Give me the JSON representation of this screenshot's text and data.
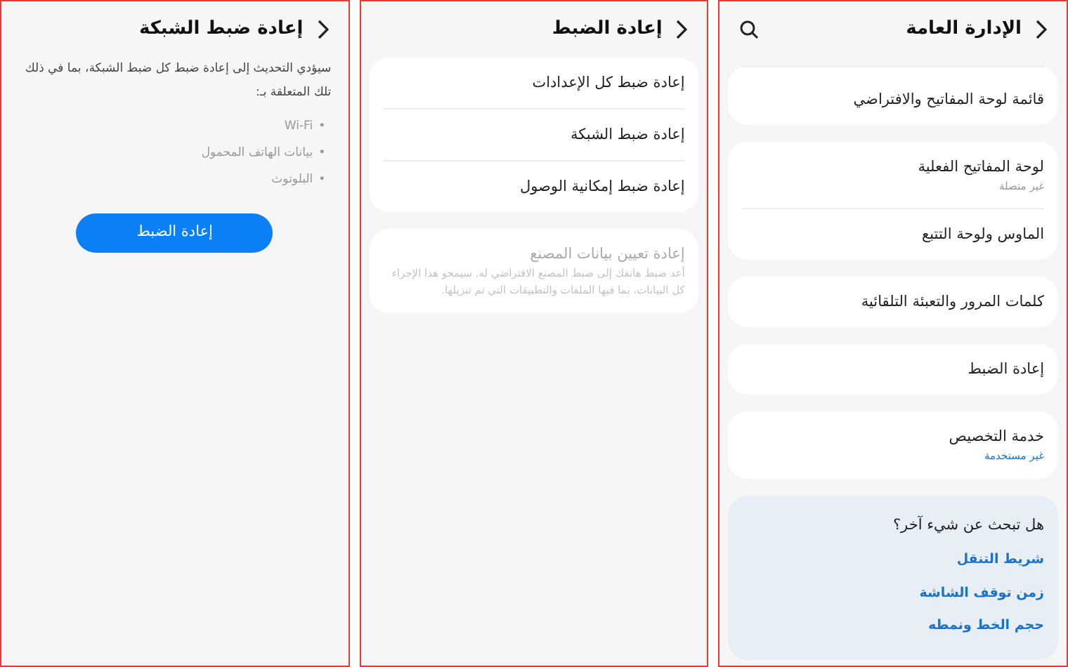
{
  "network_reset_screen": {
    "title": "إعادة ضبط الشبكة",
    "description": "سيؤدي التحديث إلى إعادة ضبط كل ضبط الشبكة، بما في ذلك تلك المتعلقة بـ:",
    "bullet": "•",
    "bullets": [
      "Wi-Fi",
      "بيانات الهاتف المحمول",
      "البلوتوث"
    ],
    "button": "إعادة الضبط"
  },
  "reset_screen": {
    "title": "إعادة الضبط",
    "groups": [
      {
        "items": [
          {
            "label": "إعادة ضبط كل الإعدادات",
            "disabled": false
          },
          {
            "label": "إعادة ضبط الشبكة",
            "disabled": false
          },
          {
            "label": "إعادة ضبط إمكانية الوصول",
            "disabled": false
          }
        ]
      },
      {
        "items": [
          {
            "label": "إعادة تعيين بيانات المصنع",
            "description": "أعد ضبط هاتفك إلى ضبط المصنع الافتراضي له. سيمحو هذا الإجراء كل البيانات، بما فيها الملفات والتطبيقات التي تم تنزيلها.",
            "disabled": true
          }
        ]
      }
    ]
  },
  "general_management_screen": {
    "title": "الإدارة العامة",
    "groups": [
      {
        "items": [
          {
            "kind": "plain",
            "label": "قائمة لوحة المفاتيح والافتراضي"
          }
        ]
      },
      {
        "items": [
          {
            "kind": "status",
            "label": "لوحة المفاتيح الفعلية",
            "subtitle": "غير متصلة"
          },
          {
            "kind": "plain",
            "label": "الماوس ولوحة التتبع"
          }
        ]
      },
      {
        "items": [
          {
            "kind": "plain",
            "label": "كلمات المرور والتعبئة التلقائية"
          }
        ]
      },
      {
        "items": [
          {
            "kind": "plain",
            "label": "إعادة الضبط"
          }
        ]
      },
      {
        "items": [
          {
            "kind": "link",
            "label": "خدمة التخصيص",
            "subtitle": "غير مستخدمة"
          }
        ]
      }
    ],
    "suggestions": {
      "heading": "هل تبحث عن شيء آخر؟",
      "links": [
        "شريط التنقل",
        "زمن توقف الشاشة",
        "حجم الخط ونمطه"
      ]
    }
  }
}
